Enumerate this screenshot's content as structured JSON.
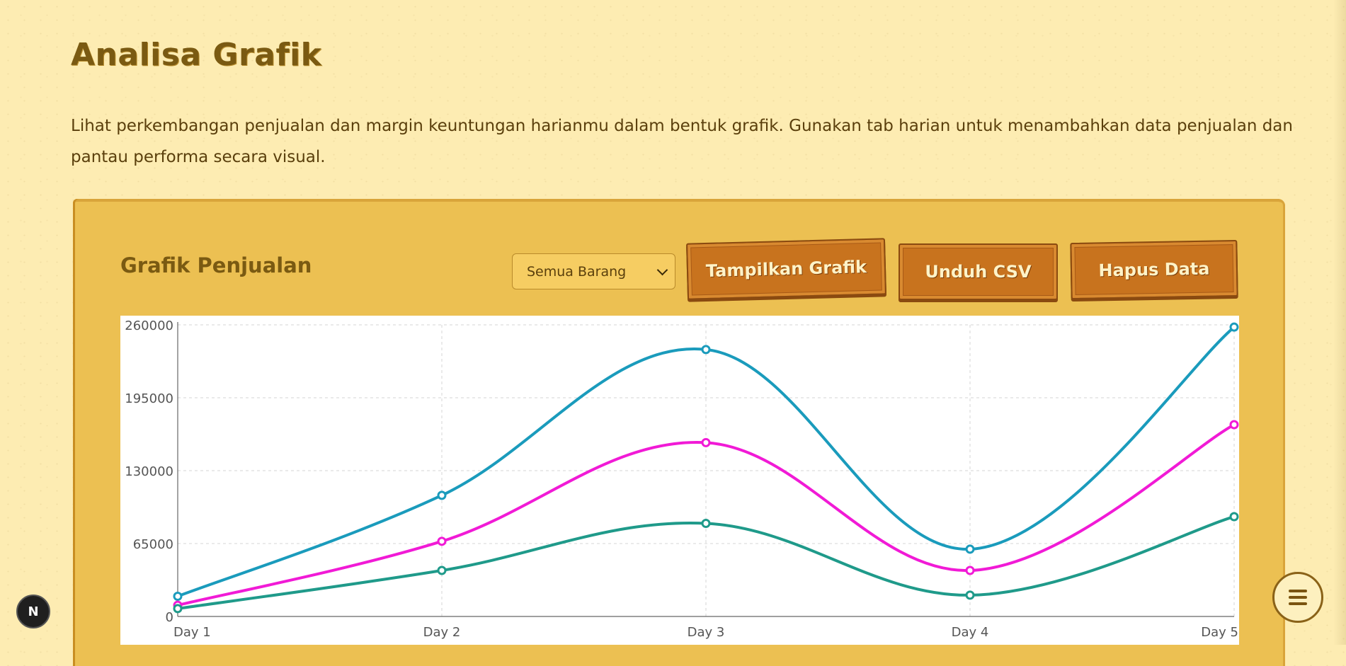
{
  "header": {
    "title": "Analisa Grafik",
    "intro": "Lihat perkembangan penjualan dan margin keuntungan harianmu dalam bentuk grafik. Gunakan tab harian untuk menambahkan data penjualan dan pantau performa secara visual."
  },
  "panel": {
    "title": "Grafik Penjualan",
    "select": {
      "value": "Semua Barang"
    },
    "buttons": {
      "show": "Tampilkan Grafik",
      "download": "Unduh CSV",
      "clear": "Hapus Data"
    }
  },
  "badge": {
    "label": "N"
  },
  "colors": {
    "background": "#fdecb2",
    "panel": "#ecc052",
    "button": "#c8731e",
    "title": "#7a5a12"
  },
  "icons": {
    "menu": "hamburger-icon",
    "select_arrow": "chevron-down-icon"
  },
  "chart_data": {
    "type": "line",
    "categories": [
      "Day 1",
      "Day 2",
      "Day 3",
      "Day 4",
      "Day 5"
    ],
    "yticks": [
      "0",
      "65000",
      "130000",
      "195000",
      "260000"
    ],
    "ylim": [
      0,
      260000
    ],
    "grid": true,
    "smooth": true,
    "series": [
      {
        "color": "#1a9bbc",
        "values": [
          18000,
          108000,
          238000,
          60000,
          258000
        ]
      },
      {
        "color": "#f11ad6",
        "values": [
          10000,
          67000,
          155000,
          41000,
          171000
        ]
      },
      {
        "color": "#1f9a8a",
        "values": [
          7000,
          41000,
          83000,
          19000,
          89000
        ]
      }
    ]
  }
}
